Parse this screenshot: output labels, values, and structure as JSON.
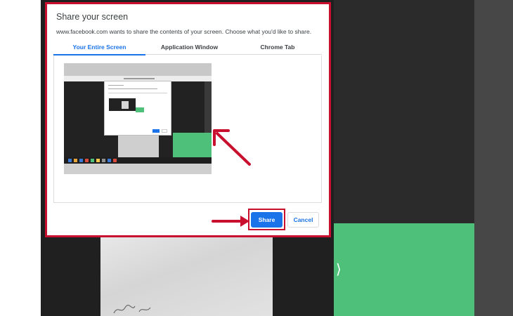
{
  "dialog": {
    "title": "Share your screen",
    "description": "www.facebook.com wants to share the contents of your screen. Choose what you'd like to share.",
    "tabs": [
      {
        "label": "Your Entire Screen",
        "selected": true
      },
      {
        "label": "Application Window",
        "selected": false
      },
      {
        "label": "Chrome Tab",
        "selected": false
      }
    ],
    "buttons": {
      "share_label": "Share",
      "cancel_label": "Cancel"
    }
  },
  "background": {
    "next_glyph": "⟩"
  },
  "icons": {
    "next_icon": "next-arrow",
    "annotation": "red-arrow"
  },
  "colors": {
    "accent": "#1a73e8",
    "highlight": "#c8102e",
    "green_screen": "#4ec07a",
    "dark_background": "#202020"
  }
}
